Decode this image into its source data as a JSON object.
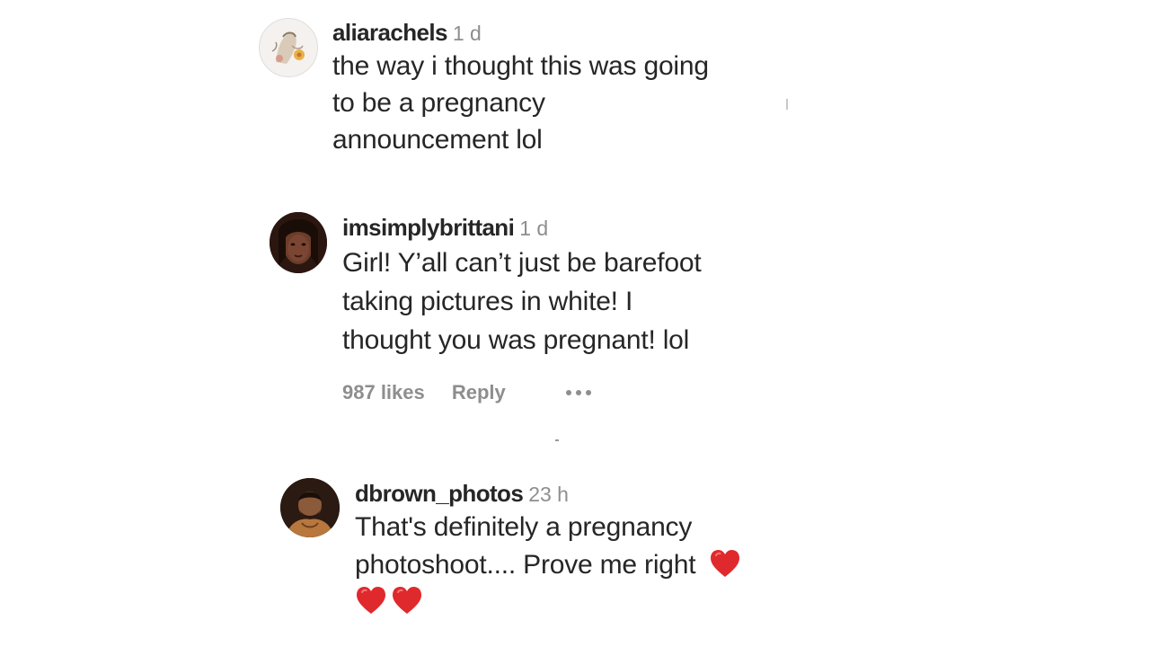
{
  "comments": [
    {
      "username": "aliarachels",
      "time": "1 d",
      "lines": [
        "the way i thought this was going",
        "to be a pregnancy",
        "announcement lol"
      ]
    },
    {
      "username": "imsimplybrittani",
      "time": "1 d",
      "lines": [
        "Girl! Y’all can’t just be barefoot",
        "taking pictures in white! I",
        "thought you was pregnant! lol"
      ],
      "likes": "987 likes",
      "reply": "Reply"
    },
    {
      "username": "dbrown_photos",
      "time": "23 h",
      "lines": [
        "That's definitely a pregnancy",
        "photoshoot.... Prove me right"
      ]
    }
  ],
  "icons": {
    "more": "more-options-icon",
    "heart": "red-heart-emoji",
    "heart_color": "#e0292c"
  }
}
